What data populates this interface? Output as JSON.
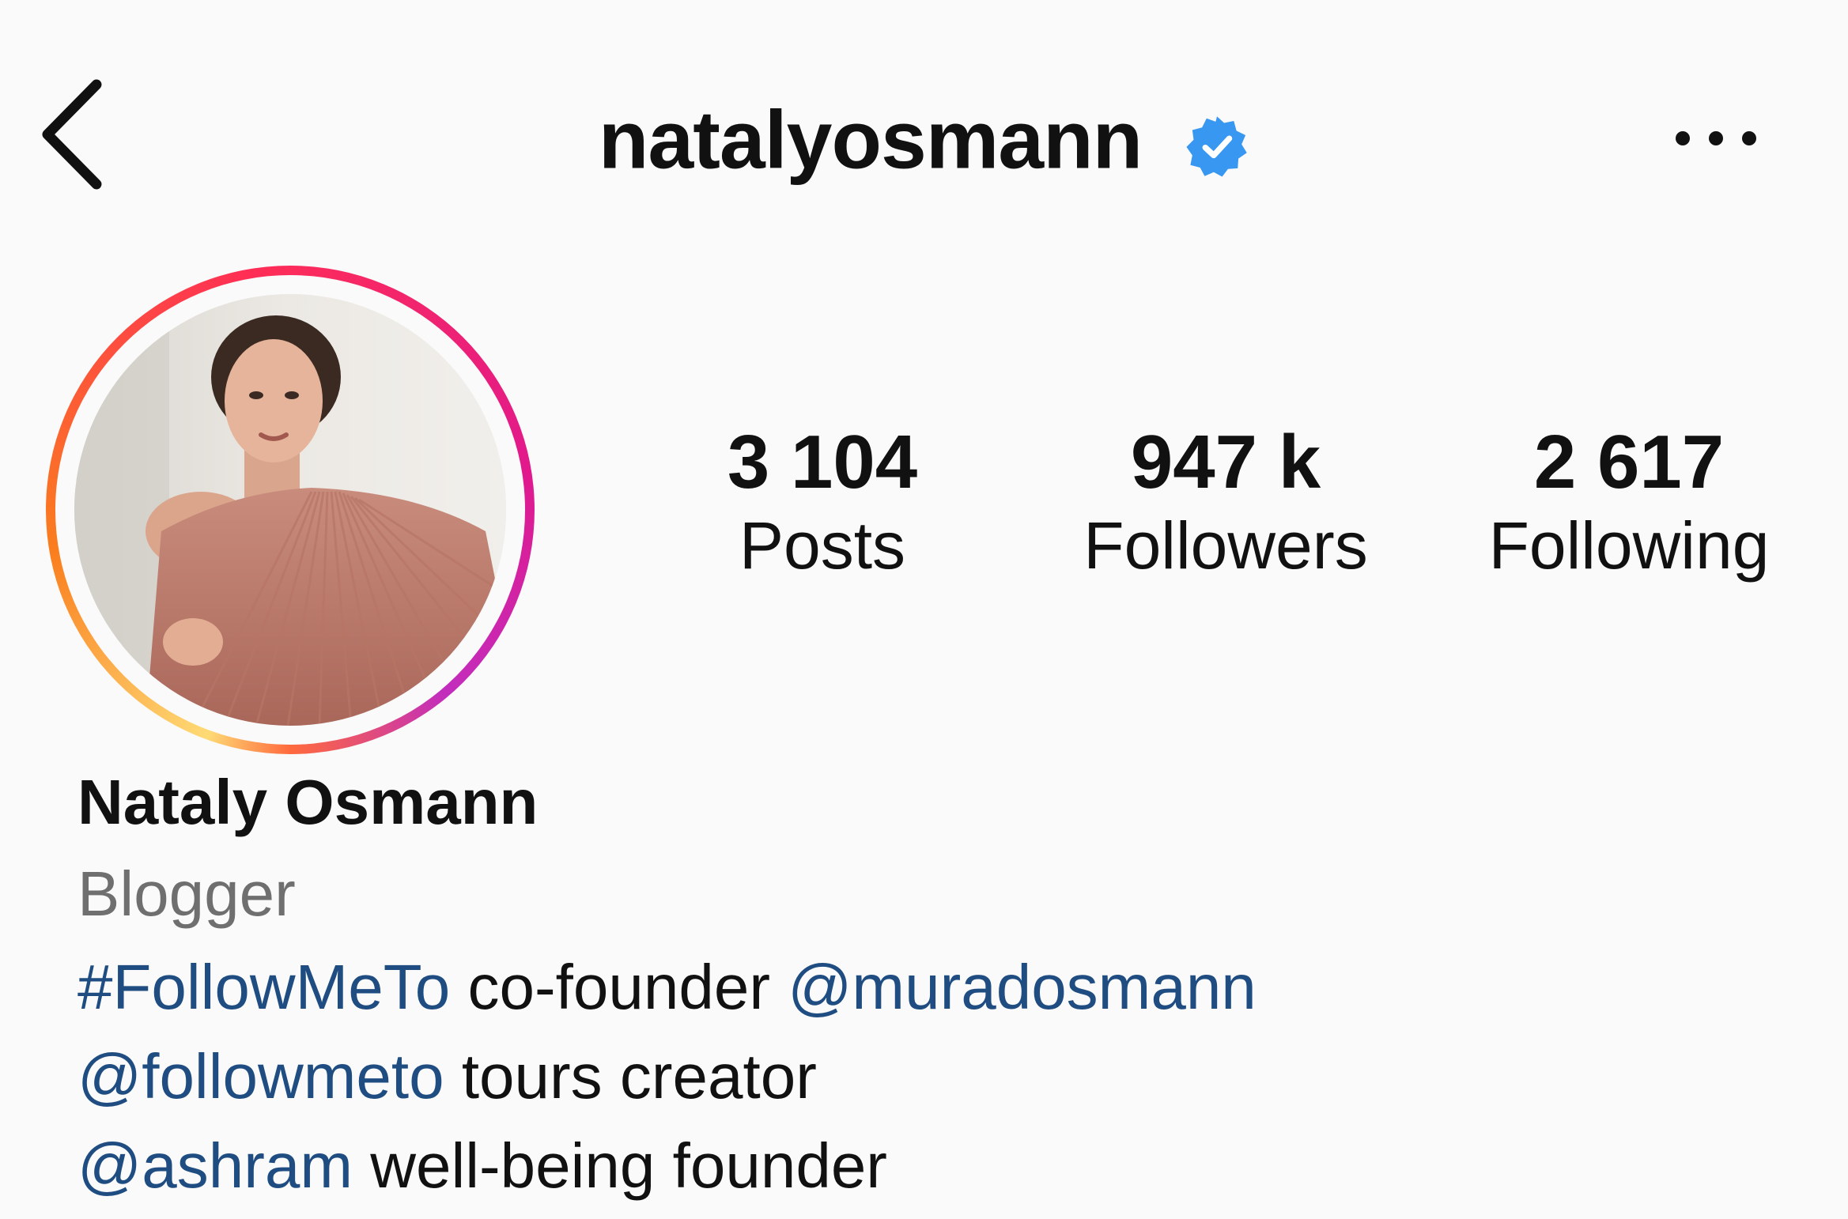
{
  "header": {
    "username": "natalyosmann",
    "verified": true,
    "back_icon": "chevron-left-icon",
    "more_icon": "more-horizontal-icon"
  },
  "profile": {
    "avatar_description": "profile-photo",
    "story_ring": true
  },
  "stats": {
    "posts": {
      "value": "3 104",
      "label": "Posts"
    },
    "followers": {
      "value": "947 k",
      "label": "Followers"
    },
    "following": {
      "value": "2 617",
      "label": "Following"
    }
  },
  "bio": {
    "full_name": "Nataly Osmann",
    "category": "Blogger",
    "lines": [
      {
        "link1": "#FollowMeTo",
        "text1": " co-founder ",
        "link2": "@muradosmann"
      },
      {
        "link1": "@followmeto",
        "text1": " tours creator"
      },
      {
        "link1": "@ashram",
        "text1": " well-being founder"
      }
    ]
  },
  "colors": {
    "background": "#fafafa",
    "text": "#111111",
    "link": "#1f4d82",
    "secondary": "#6f6f6f",
    "verified": "#3897f0"
  }
}
